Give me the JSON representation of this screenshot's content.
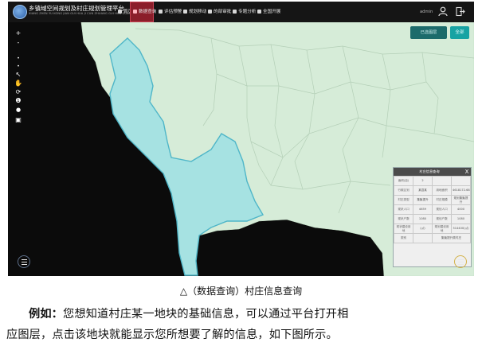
{
  "header": {
    "title": "乡镇域空间规划及村庄规划管理平台",
    "subtitle": "XIANG ZHEN YU KONG JIAN GUI HUA JI CUN ZHUANG GUI HUA GUAN LI PING TAI",
    "nav": [
      {
        "label": "首页",
        "icon": "home-icon",
        "active": false
      },
      {
        "label": "数据查询",
        "icon": "search-icon",
        "active": true
      },
      {
        "label": "评估预警",
        "icon": "warning-icon",
        "active": false
      },
      {
        "label": "规划移动",
        "icon": "mobile-icon",
        "active": false
      },
      {
        "label": "的部审批",
        "icon": "approval-icon",
        "active": false
      },
      {
        "label": "专题分析",
        "icon": "analysis-icon",
        "active": false
      },
      {
        "label": "全国开展",
        "icon": "globe-icon",
        "active": false
      }
    ],
    "user": "admin",
    "user_icon": "user-icon",
    "exit_icon": "logout-icon"
  },
  "map": {
    "layer_button": "已选图层",
    "all_button": "全部",
    "tools": [
      "+",
      "-",
      "•",
      "•",
      "↖",
      "✋",
      "⟳",
      "❶",
      "●",
      "▣"
    ],
    "colors": {
      "background": "#0b0b0b",
      "land": "#d6ecd8",
      "selected_parcel": "#a6e2e2",
      "selected_border": "#4fb6c8"
    }
  },
  "info_panel": {
    "title": "村庄信息查询",
    "close_label": "X",
    "rows": [
      [
        "面积(亩)",
        "2",
        "",
        ""
      ],
      [
        "行政区划",
        "某县某",
        "用地面积",
        "4618172.68(㎡)"
      ],
      [
        "村庄类型",
        "集聚提升",
        "村庄规模",
        "规划集聚提升"
      ],
      [
        "现状人口",
        "4659",
        "规划人口",
        "4000"
      ],
      [
        "现状户数",
        "1080",
        "规划户数",
        "1080"
      ],
      [
        "现状建设用地",
        "(㎡)",
        "规划建设用地",
        "514400(㎡)"
      ],
      [
        "类别",
        "",
        "集聚提升类村庄",
        ""
      ]
    ]
  },
  "caption": "△（数据查询）村庄信息查询",
  "paragraph": {
    "lead": "例如：",
    "line1": "您想知道村庄某一地块的基础信息，可以通过平台打开相",
    "line2": "应图层，点击该地块就能显示您所想要了解的信息，如下图所示。"
  }
}
